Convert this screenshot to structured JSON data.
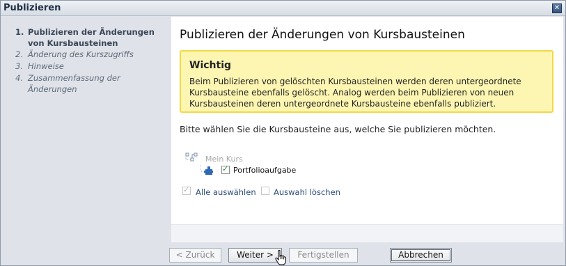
{
  "window": {
    "title": "Publizieren",
    "close_icon": "close-icon"
  },
  "wizard": {
    "steps": [
      {
        "num": "1.",
        "label": "Publizieren der Änderungen von Kursbausteinen",
        "active": true
      },
      {
        "num": "2.",
        "label": "Änderung des Kurszugriffs",
        "active": false
      },
      {
        "num": "3.",
        "label": "Hinweise",
        "active": false
      },
      {
        "num": "4.",
        "label": "Zusammenfassung der Änderungen",
        "active": false
      }
    ]
  },
  "main": {
    "heading": "Publizieren der Änderungen von Kursbausteinen",
    "warning": {
      "title": "Wichtig",
      "body": "Beim Publizieren von gelöschten Kursbausteinen werden deren untergeordnete Kursbausteine ebenfalls gelöscht. Analog werden beim Publizieren von neuen Kursbausteinen deren untergeordnete Kursbausteine ebenfalls publiziert."
    },
    "prompt": "Bitte wählen Sie die Kursbausteine aus, welche Sie publizieren möchten.",
    "tree": {
      "root": {
        "label": "Mein Kurs",
        "icon": "course-tree-icon"
      },
      "children": [
        {
          "label": "Portfolioaufgabe",
          "icon": "portfolio-task-icon",
          "checked": true
        }
      ]
    },
    "selection": {
      "select_all_label": "Alle auswählen",
      "select_all_checked": true,
      "clear_label": "Auswahl löschen",
      "clear_checked": false
    }
  },
  "buttons": {
    "back": "< Zurück",
    "next": "Weiter >",
    "finish": "Fertigstellen",
    "cancel": "Abbrechen"
  },
  "colors": {
    "warning_bg": "#fdf6b2",
    "warning_border": "#f2d943",
    "link": "#2a4c7a",
    "check": "#1f8a2b"
  }
}
